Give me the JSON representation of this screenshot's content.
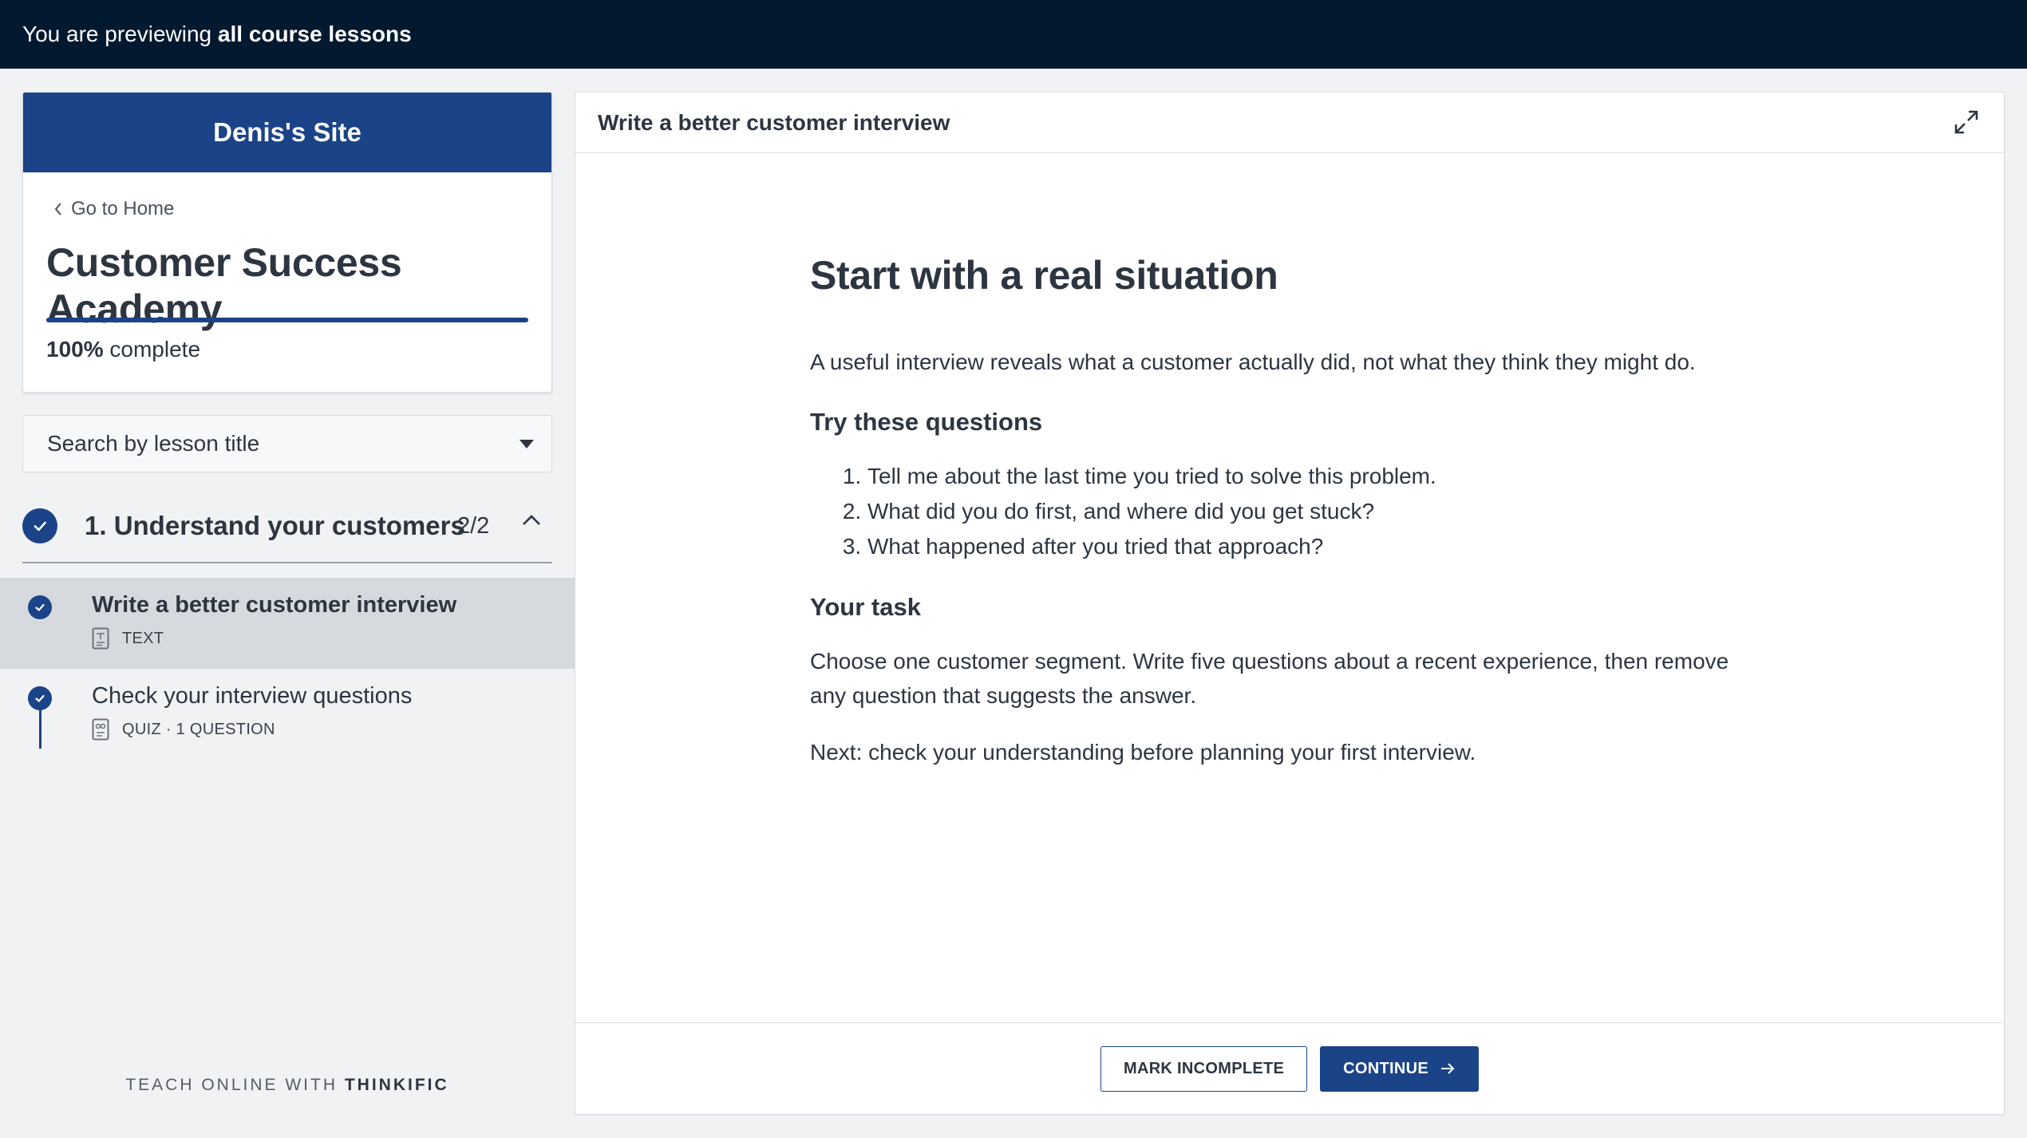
{
  "preview_bar": {
    "prefix": "You are previewing",
    "emphasis": "all course lessons"
  },
  "sidebar": {
    "site_name": "Denis's Site",
    "go_home": "Go to Home",
    "course_title": "Customer Success Academy",
    "progress": {
      "percent_label": "100%",
      "suffix": "complete",
      "value": 1.0
    },
    "search_placeholder": "Search by lesson title",
    "chapter": {
      "title": "1. Understand your customers",
      "count": "2/2",
      "expanded": true
    },
    "lessons": [
      {
        "title": "Write a better customer interview",
        "type_label": "TEXT",
        "icon": "text-document-icon",
        "active": true,
        "completed": true
      },
      {
        "title": "Check your interview questions",
        "type_label": "QUIZ · 1 QUESTION",
        "icon": "quiz-icon",
        "active": false,
        "completed": true
      }
    ],
    "footer": {
      "prefix": "TEACH ONLINE WITH",
      "brand": "THINKIFIC"
    }
  },
  "main": {
    "header_title": "Write a better customer interview",
    "heading": "Start with a real situation",
    "intro": "A useful interview reveals what a customer actually did, not what they think they might do.",
    "questions_heading": "Try these questions",
    "questions": [
      "Tell me about the last time you tried to solve this problem.",
      "What did you do first, and where did you get stuck?",
      "What happened after you tried that approach?"
    ],
    "task_heading": "Your task",
    "task_text": "Choose one customer segment. Write five questions about a recent experience, then remove any question that suggests the answer.",
    "next_text": "Next: check your understanding before planning your first interview.",
    "buttons": {
      "mark_incomplete": "MARK INCOMPLETE",
      "continue": "CONTINUE"
    }
  },
  "colors": {
    "accent": "#1a4388",
    "top_bar": "#021930",
    "sidebar_bg": "#f1f2f4",
    "active_lesson_bg": "#d6d9de"
  }
}
